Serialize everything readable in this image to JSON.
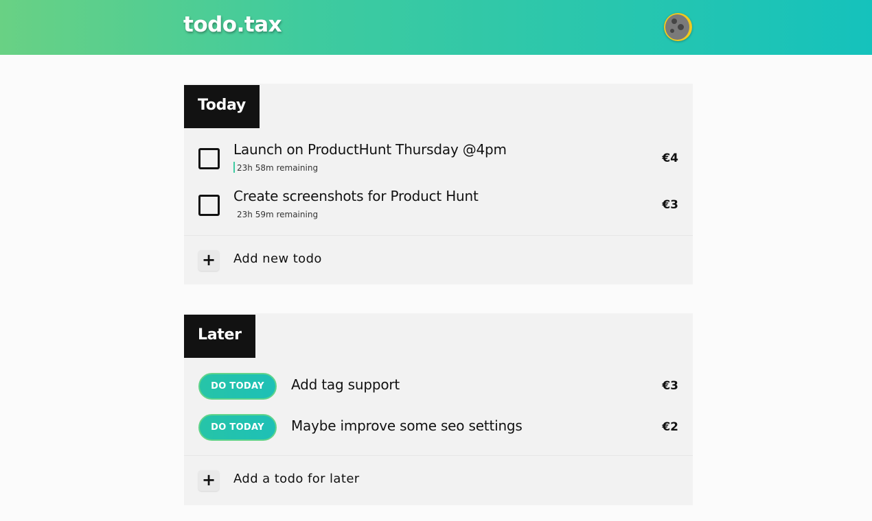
{
  "header": {
    "logo": "todo.tax",
    "avatar_icon": "moon-icon",
    "gradient": [
      "#69d184",
      "#15c2bc"
    ]
  },
  "today": {
    "title": "Today",
    "items": [
      {
        "title": "Launch on ProductHunt Thursday @4pm",
        "remaining": "23h 58m remaining",
        "price": "€4"
      },
      {
        "title": "Create screenshots for Product Hunt",
        "remaining": "23h 59m remaining",
        "price": "€3"
      }
    ],
    "add_label": "Add new todo",
    "add_icon": "plus-icon"
  },
  "later": {
    "title": "Later",
    "items": [
      {
        "button": "DO TODAY",
        "title": "Add tag support",
        "price": "€3"
      },
      {
        "button": "DO TODAY",
        "title": "Maybe improve some seo settings",
        "price": "€2"
      }
    ],
    "add_label": "Add a todo for later",
    "add_icon": "plus-icon"
  },
  "colors": {
    "accent": "#1ec0b6",
    "title_bg": "#121212",
    "card_bg": "#f2f2f2"
  }
}
